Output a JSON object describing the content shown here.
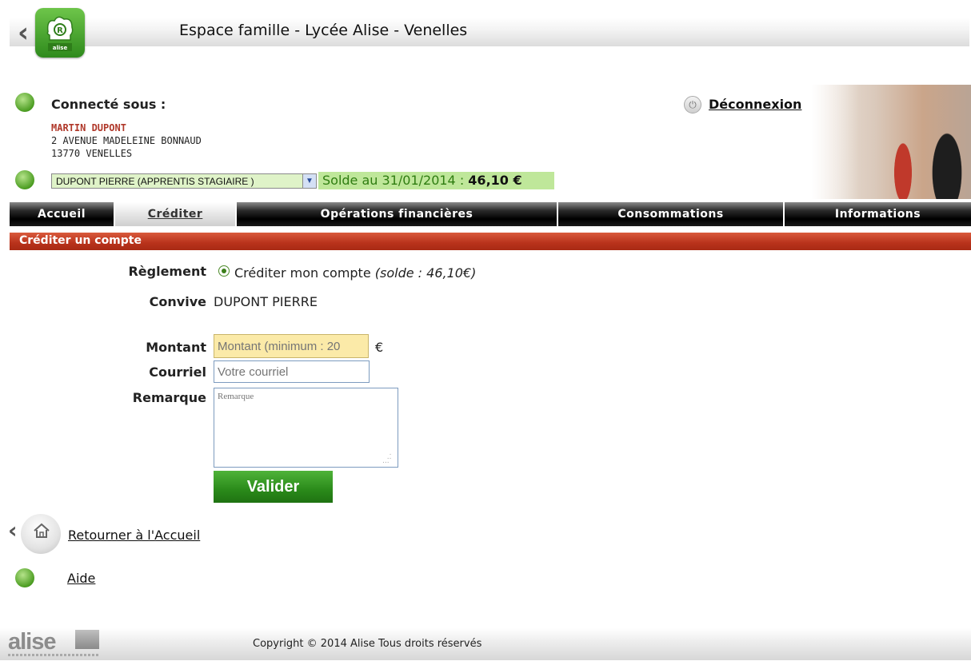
{
  "header": {
    "title": "Espace famille - Lycée Alise - Venelles"
  },
  "user": {
    "connected_label": "Connecté sous :",
    "name": "MARTIN DUPONT",
    "address_line1": "2 AVENUE MADELEINE BONNAUD",
    "address_line2": "13770 VENELLES",
    "logout_label": "Déconnexion"
  },
  "convive_select": {
    "selected": "DUPONT PIERRE (APPRENTIS STAGIAIRE )"
  },
  "balance": {
    "label": "Solde au 31/01/2014 : ",
    "amount": "46,10 €"
  },
  "nav": {
    "items": [
      {
        "label": "Accueil",
        "active": false
      },
      {
        "label": "Créditer",
        "active": true
      },
      {
        "label": "Opérations financières",
        "active": false
      },
      {
        "label": "Consommations",
        "active": false
      },
      {
        "label": "Informations",
        "active": false
      }
    ]
  },
  "section": {
    "title": "Créditer un compte"
  },
  "form": {
    "reglement_label": "Règlement",
    "reglement_option": "Créditer mon compte",
    "reglement_hint": "(solde : 46,10€)",
    "convive_label": "Convive",
    "convive_value": "DUPONT PIERRE",
    "montant_label": "Montant",
    "montant_placeholder": "Montant (minimum : 20",
    "currency": "€",
    "courriel_label": "Courriel",
    "courriel_placeholder": "Votre courriel",
    "remarque_label": "Remarque",
    "remarque_placeholder": "Remarque",
    "submit_label": "Valider"
  },
  "links": {
    "home": "Retourner à l'Accueil",
    "help": "Aide"
  },
  "footer": {
    "logo_text": "alise",
    "copyright": "Copyright © 2014 Alise Tous droits réservés"
  },
  "colors": {
    "section_red": "#b8321b",
    "balance_green": "#bfe79a",
    "button_green": "#2a8a1a",
    "user_name_red": "#b0382a"
  },
  "icons": [
    "back-chevron-icon",
    "alise-app-logo",
    "user-icon",
    "switch-user-icon",
    "power-icon",
    "dropdown-arrow-icon",
    "home-icon",
    "info-icon"
  ]
}
